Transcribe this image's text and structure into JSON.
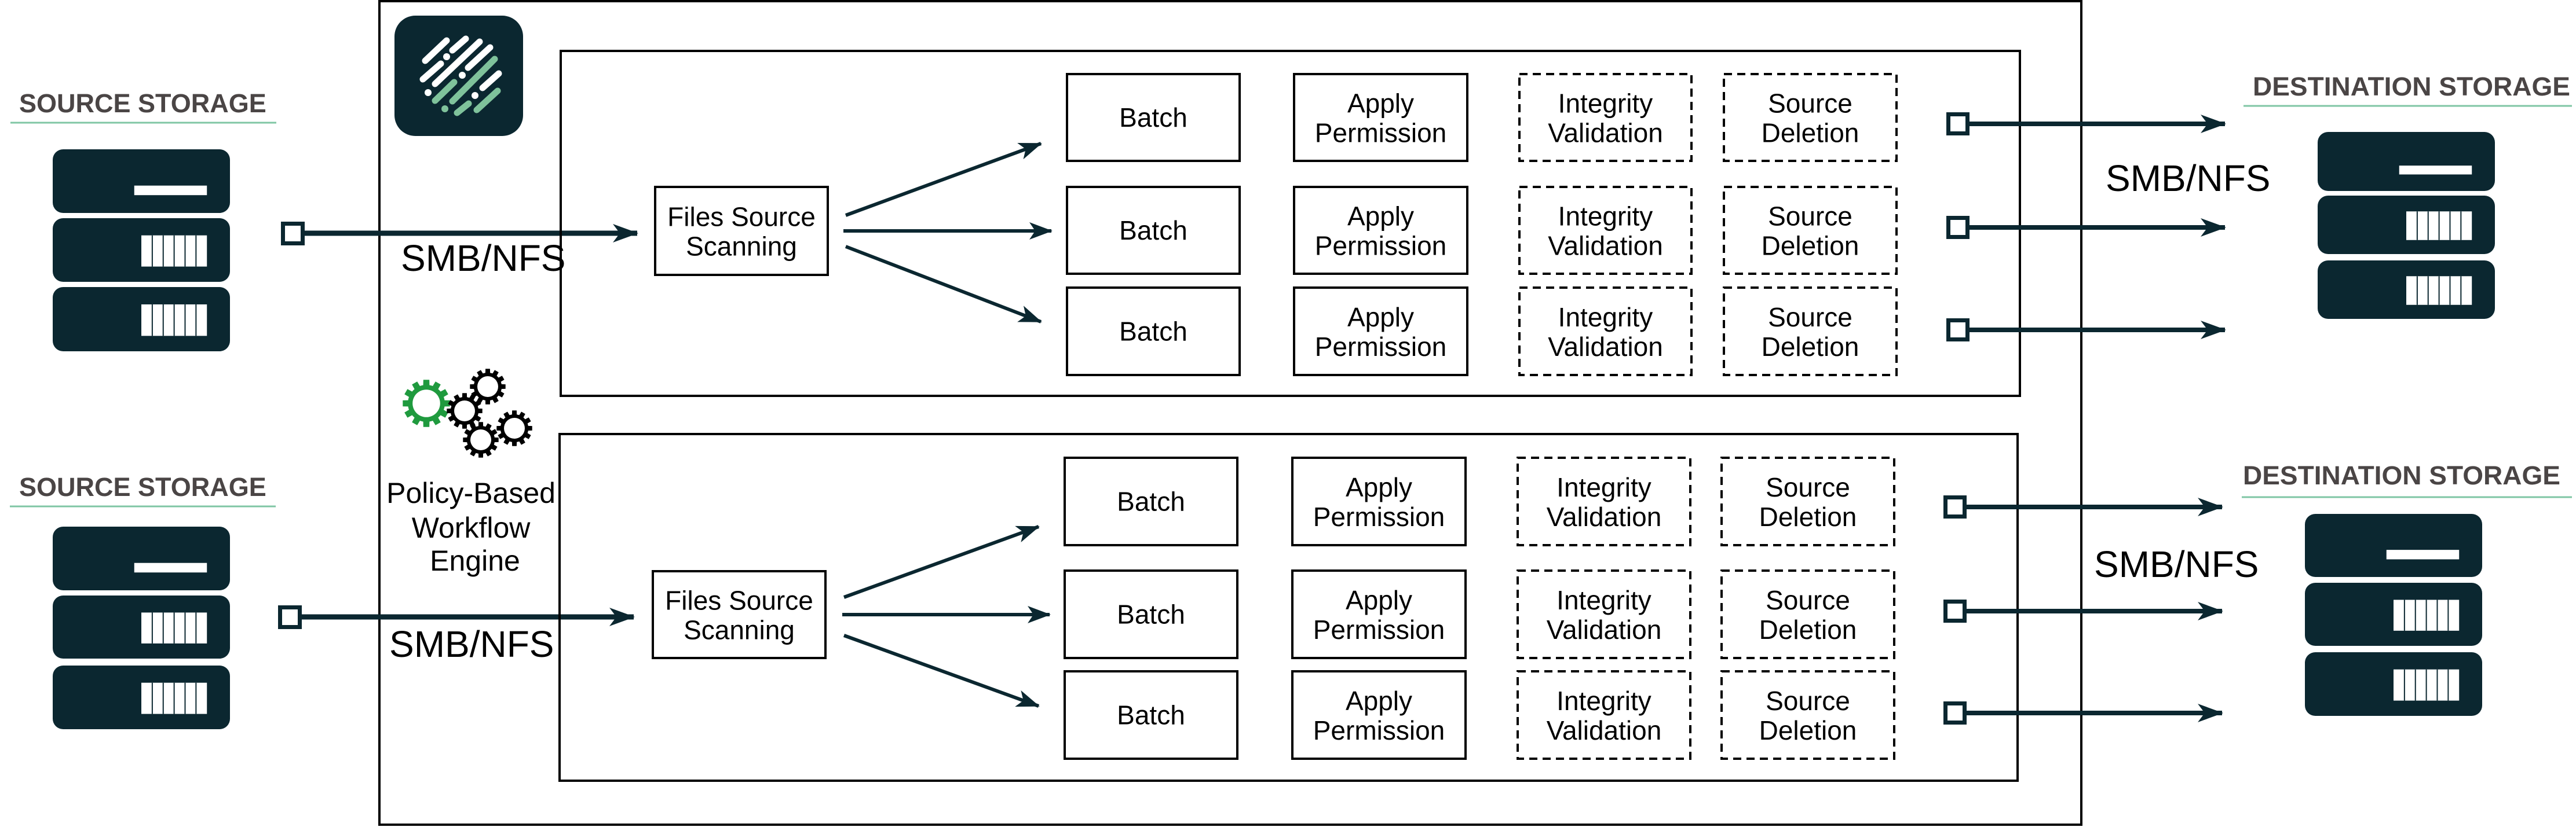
{
  "colors": {
    "dark": "#0b2730",
    "accent_green": "#7fc29b",
    "underline": "#7fc6a4",
    "gear_green": "#1f9a3e",
    "heading": "#4a4545",
    "line": "#000000"
  },
  "logo": {
    "icon": "company-logo-icon"
  },
  "engine": {
    "icon": "gears-icon",
    "label_lines": [
      "Policy-Based",
      "Workflow",
      "Engine"
    ]
  },
  "flows": [
    {
      "source": {
        "label": "SOURCE STORAGE",
        "icon": "server-icon"
      },
      "inbound_protocol": "SMB/NFS",
      "scanner": {
        "lines": [
          "Files Source",
          "Scanning"
        ]
      },
      "rows": [
        {
          "batch": "Batch",
          "apply": [
            "Apply",
            "Permission"
          ],
          "integrity": [
            "Integrity",
            "Validation"
          ],
          "deletion": [
            "Source",
            "Deletion"
          ]
        },
        {
          "batch": "Batch",
          "apply": [
            "Apply",
            "Permission"
          ],
          "integrity": [
            "Integrity",
            "Validation"
          ],
          "deletion": [
            "Source",
            "Deletion"
          ]
        },
        {
          "batch": "Batch",
          "apply": [
            "Apply",
            "Permission"
          ],
          "integrity": [
            "Integrity",
            "Validation"
          ],
          "deletion": [
            "Source",
            "Deletion"
          ]
        }
      ],
      "outbound_protocol": "SMB/NFS",
      "destination": {
        "label": "DESTINATION STORAGE",
        "icon": "server-icon"
      }
    },
    {
      "source": {
        "label": "SOURCE STORAGE",
        "icon": "server-icon"
      },
      "inbound_protocol": "SMB/NFS",
      "scanner": {
        "lines": [
          "Files Source",
          "Scanning"
        ]
      },
      "rows": [
        {
          "batch": "Batch",
          "apply": [
            "Apply",
            "Permission"
          ],
          "integrity": [
            "Integrity",
            "Validation"
          ],
          "deletion": [
            "Source",
            "Deletion"
          ]
        },
        {
          "batch": "Batch",
          "apply": [
            "Apply",
            "Permission"
          ],
          "integrity": [
            "Integrity",
            "Validation"
          ],
          "deletion": [
            "Source",
            "Deletion"
          ]
        },
        {
          "batch": "Batch",
          "apply": [
            "Apply",
            "Permission"
          ],
          "integrity": [
            "Integrity",
            "Validation"
          ],
          "deletion": [
            "Source",
            "Deletion"
          ]
        }
      ],
      "outbound_protocol": "SMB/NFS",
      "destination": {
        "label": "DESTINATION STORAGE",
        "icon": "server-icon"
      }
    }
  ]
}
